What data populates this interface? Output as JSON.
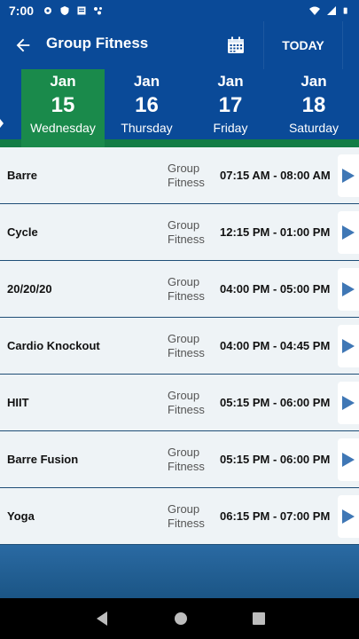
{
  "status_bar": {
    "time": "7:00",
    "left_icons": [
      "gear-icon",
      "shield-icon",
      "news-icon",
      "assistant-icon"
    ],
    "right_icons": [
      "wifi-icon",
      "signal-icon",
      "battery-icon"
    ]
  },
  "app_bar": {
    "title": "Group Fitness",
    "back_icon": "arrow-left-icon",
    "calendar_icon": "calendar-icon",
    "today_label": "TODAY"
  },
  "dates": [
    {
      "month": "Jan",
      "day": "15",
      "weekday": "Wednesday",
      "selected": true
    },
    {
      "month": "Jan",
      "day": "16",
      "weekday": "Thursday",
      "selected": false
    },
    {
      "month": "Jan",
      "day": "17",
      "weekday": "Friday",
      "selected": false
    },
    {
      "month": "Jan",
      "day": "18",
      "weekday": "Saturday",
      "selected": false
    }
  ],
  "classes": [
    {
      "name": "Barre",
      "category_line1": "Group",
      "category_line2": "Fitness",
      "time": "07:15 AM - 08:00 AM"
    },
    {
      "name": "Cycle",
      "category_line1": "Group",
      "category_line2": "Fitness",
      "time": "12:15 PM - 01:00 PM"
    },
    {
      "name": "20/20/20",
      "category_line1": "Group",
      "category_line2": "Fitness",
      "time": "04:00 PM - 05:00 PM"
    },
    {
      "name": "Cardio Knockout",
      "category_line1": "Group",
      "category_line2": "Fitness",
      "time": "04:00 PM - 04:45 PM"
    },
    {
      "name": "HIIT",
      "category_line1": "Group",
      "category_line2": "Fitness",
      "time": "05:15 PM - 06:00 PM"
    },
    {
      "name": "Barre Fusion",
      "category_line1": "Group",
      "category_line2": "Fitness",
      "time": "05:15 PM - 06:00 PM"
    },
    {
      "name": "Yoga",
      "category_line1": "Group",
      "category_line2": "Fitness",
      "time": "06:15 PM - 07:00 PM"
    }
  ],
  "colors": {
    "primary": "#0a4a98",
    "selected_date": "#1a8a4b",
    "accent_arrow": "#3f77b5"
  }
}
